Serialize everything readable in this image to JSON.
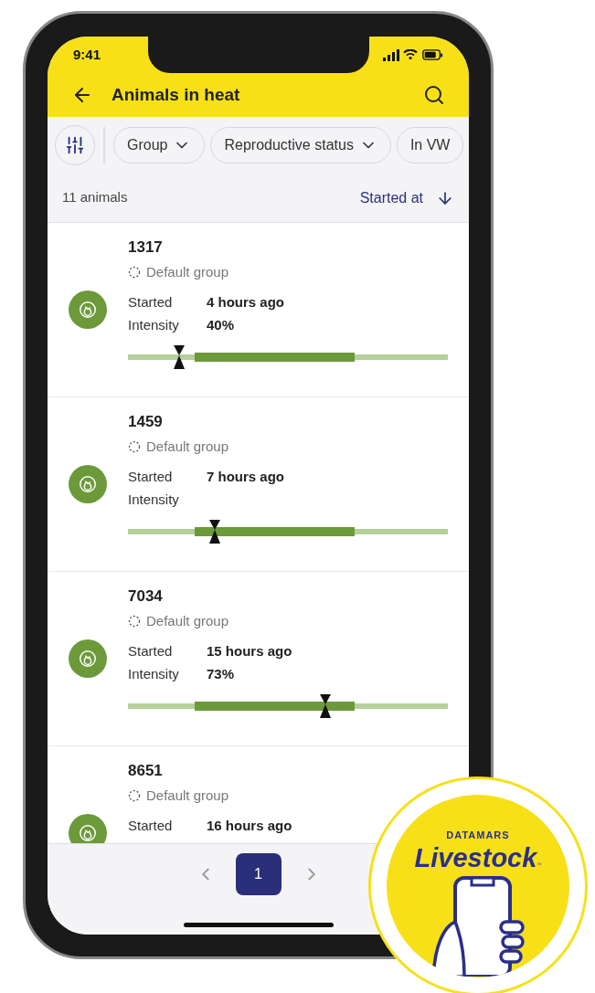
{
  "status_bar": {
    "time": "9:41"
  },
  "header": {
    "title": "Animals in heat"
  },
  "filters": [
    {
      "label": "Group"
    },
    {
      "label": "Reproductive status"
    },
    {
      "label": "In VW"
    }
  ],
  "summary": {
    "count": "11 animals",
    "sort": "Started at"
  },
  "animals": [
    {
      "id": "1317",
      "group": "Default group",
      "started_label": "Started",
      "started": "4 hours ago",
      "intensity_label": "Intensity",
      "intensity": "40%",
      "level": 0.16
    },
    {
      "id": "1459",
      "group": "Default group",
      "started_label": "Started",
      "started": "7 hours ago",
      "intensity_label": "Intensity",
      "level": 0.271
    },
    {
      "id": "7034",
      "group": "Default group",
      "started_label": "Started",
      "started": "15 hours ago",
      "intensity_label": "Intensity",
      "intensity": "73%",
      "level": 0.617
    },
    {
      "id": "8651",
      "group": "Default group",
      "started_label": "Started",
      "started": "16 hours ago"
    }
  ],
  "pagination": {
    "pages": [
      {
        "label": "1",
        "selected": true
      }
    ]
  },
  "badge": {
    "brand": "DATAMARS",
    "product": "Livestock",
    "mark": "™"
  }
}
